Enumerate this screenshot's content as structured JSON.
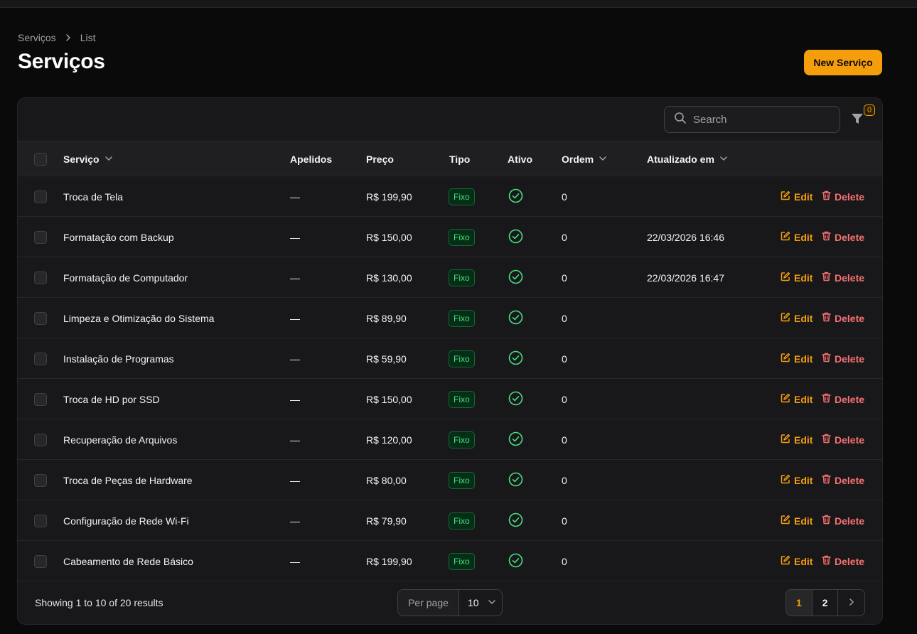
{
  "breadcrumb": [
    "Serviços",
    "List"
  ],
  "page_title": "Serviços",
  "new_button": "New Serviço",
  "search": {
    "placeholder": "Search",
    "value": ""
  },
  "filter": {
    "count": "0"
  },
  "columns": {
    "servico": "Serviço",
    "apelidos": "Apelidos",
    "preco": "Preço",
    "tipo": "Tipo",
    "ativo": "Ativo",
    "ordem": "Ordem",
    "atualizado": "Atualizado em"
  },
  "actions": {
    "edit": "Edit",
    "delete": "Delete"
  },
  "rows": [
    {
      "servico": "Troca de Tela",
      "apelidos": "—",
      "preco": "R$ 199,90",
      "tipo": "Fixo",
      "ativo": true,
      "ordem": "0",
      "atualizado": ""
    },
    {
      "servico": "Formatação com Backup",
      "apelidos": "—",
      "preco": "R$ 150,00",
      "tipo": "Fixo",
      "ativo": true,
      "ordem": "0",
      "atualizado": "22/03/2026 16:46"
    },
    {
      "servico": "Formatação de Computador",
      "apelidos": "—",
      "preco": "R$ 130,00",
      "tipo": "Fixo",
      "ativo": true,
      "ordem": "0",
      "atualizado": "22/03/2026 16:47"
    },
    {
      "servico": "Limpeza e Otimização do Sistema",
      "apelidos": "—",
      "preco": "R$ 89,90",
      "tipo": "Fixo",
      "ativo": true,
      "ordem": "0",
      "atualizado": ""
    },
    {
      "servico": "Instalação de Programas",
      "apelidos": "—",
      "preco": "R$ 59,90",
      "tipo": "Fixo",
      "ativo": true,
      "ordem": "0",
      "atualizado": ""
    },
    {
      "servico": "Troca de HD por SSD",
      "apelidos": "—",
      "preco": "R$ 150,00",
      "tipo": "Fixo",
      "ativo": true,
      "ordem": "0",
      "atualizado": ""
    },
    {
      "servico": "Recuperação de Arquivos",
      "apelidos": "—",
      "preco": "R$ 120,00",
      "tipo": "Fixo",
      "ativo": true,
      "ordem": "0",
      "atualizado": ""
    },
    {
      "servico": "Troca de Peças de Hardware",
      "apelidos": "—",
      "preco": "R$ 80,00",
      "tipo": "Fixo",
      "ativo": true,
      "ordem": "0",
      "atualizado": ""
    },
    {
      "servico": "Configuração de Rede Wi-Fi",
      "apelidos": "—",
      "preco": "R$ 79,90",
      "tipo": "Fixo",
      "ativo": true,
      "ordem": "0",
      "atualizado": ""
    },
    {
      "servico": "Cabeamento de Rede Básico",
      "apelidos": "—",
      "preco": "R$ 199,90",
      "tipo": "Fixo",
      "ativo": true,
      "ordem": "0",
      "atualizado": ""
    }
  ],
  "footer": {
    "showing": "Showing 1 to 10 of 20 results",
    "per_page_label": "Per page",
    "per_page_value": "10",
    "pages": [
      "1",
      "2"
    ],
    "current_page": "1"
  },
  "colors": {
    "accent": "#f59e0b",
    "danger": "#f87171",
    "success": "#4ade80"
  },
  "icons": [
    "chevron-right-icon",
    "search-icon",
    "funnel-icon",
    "chevron-down-icon",
    "check-circle-icon",
    "pencil-square-icon",
    "trash-icon"
  ]
}
